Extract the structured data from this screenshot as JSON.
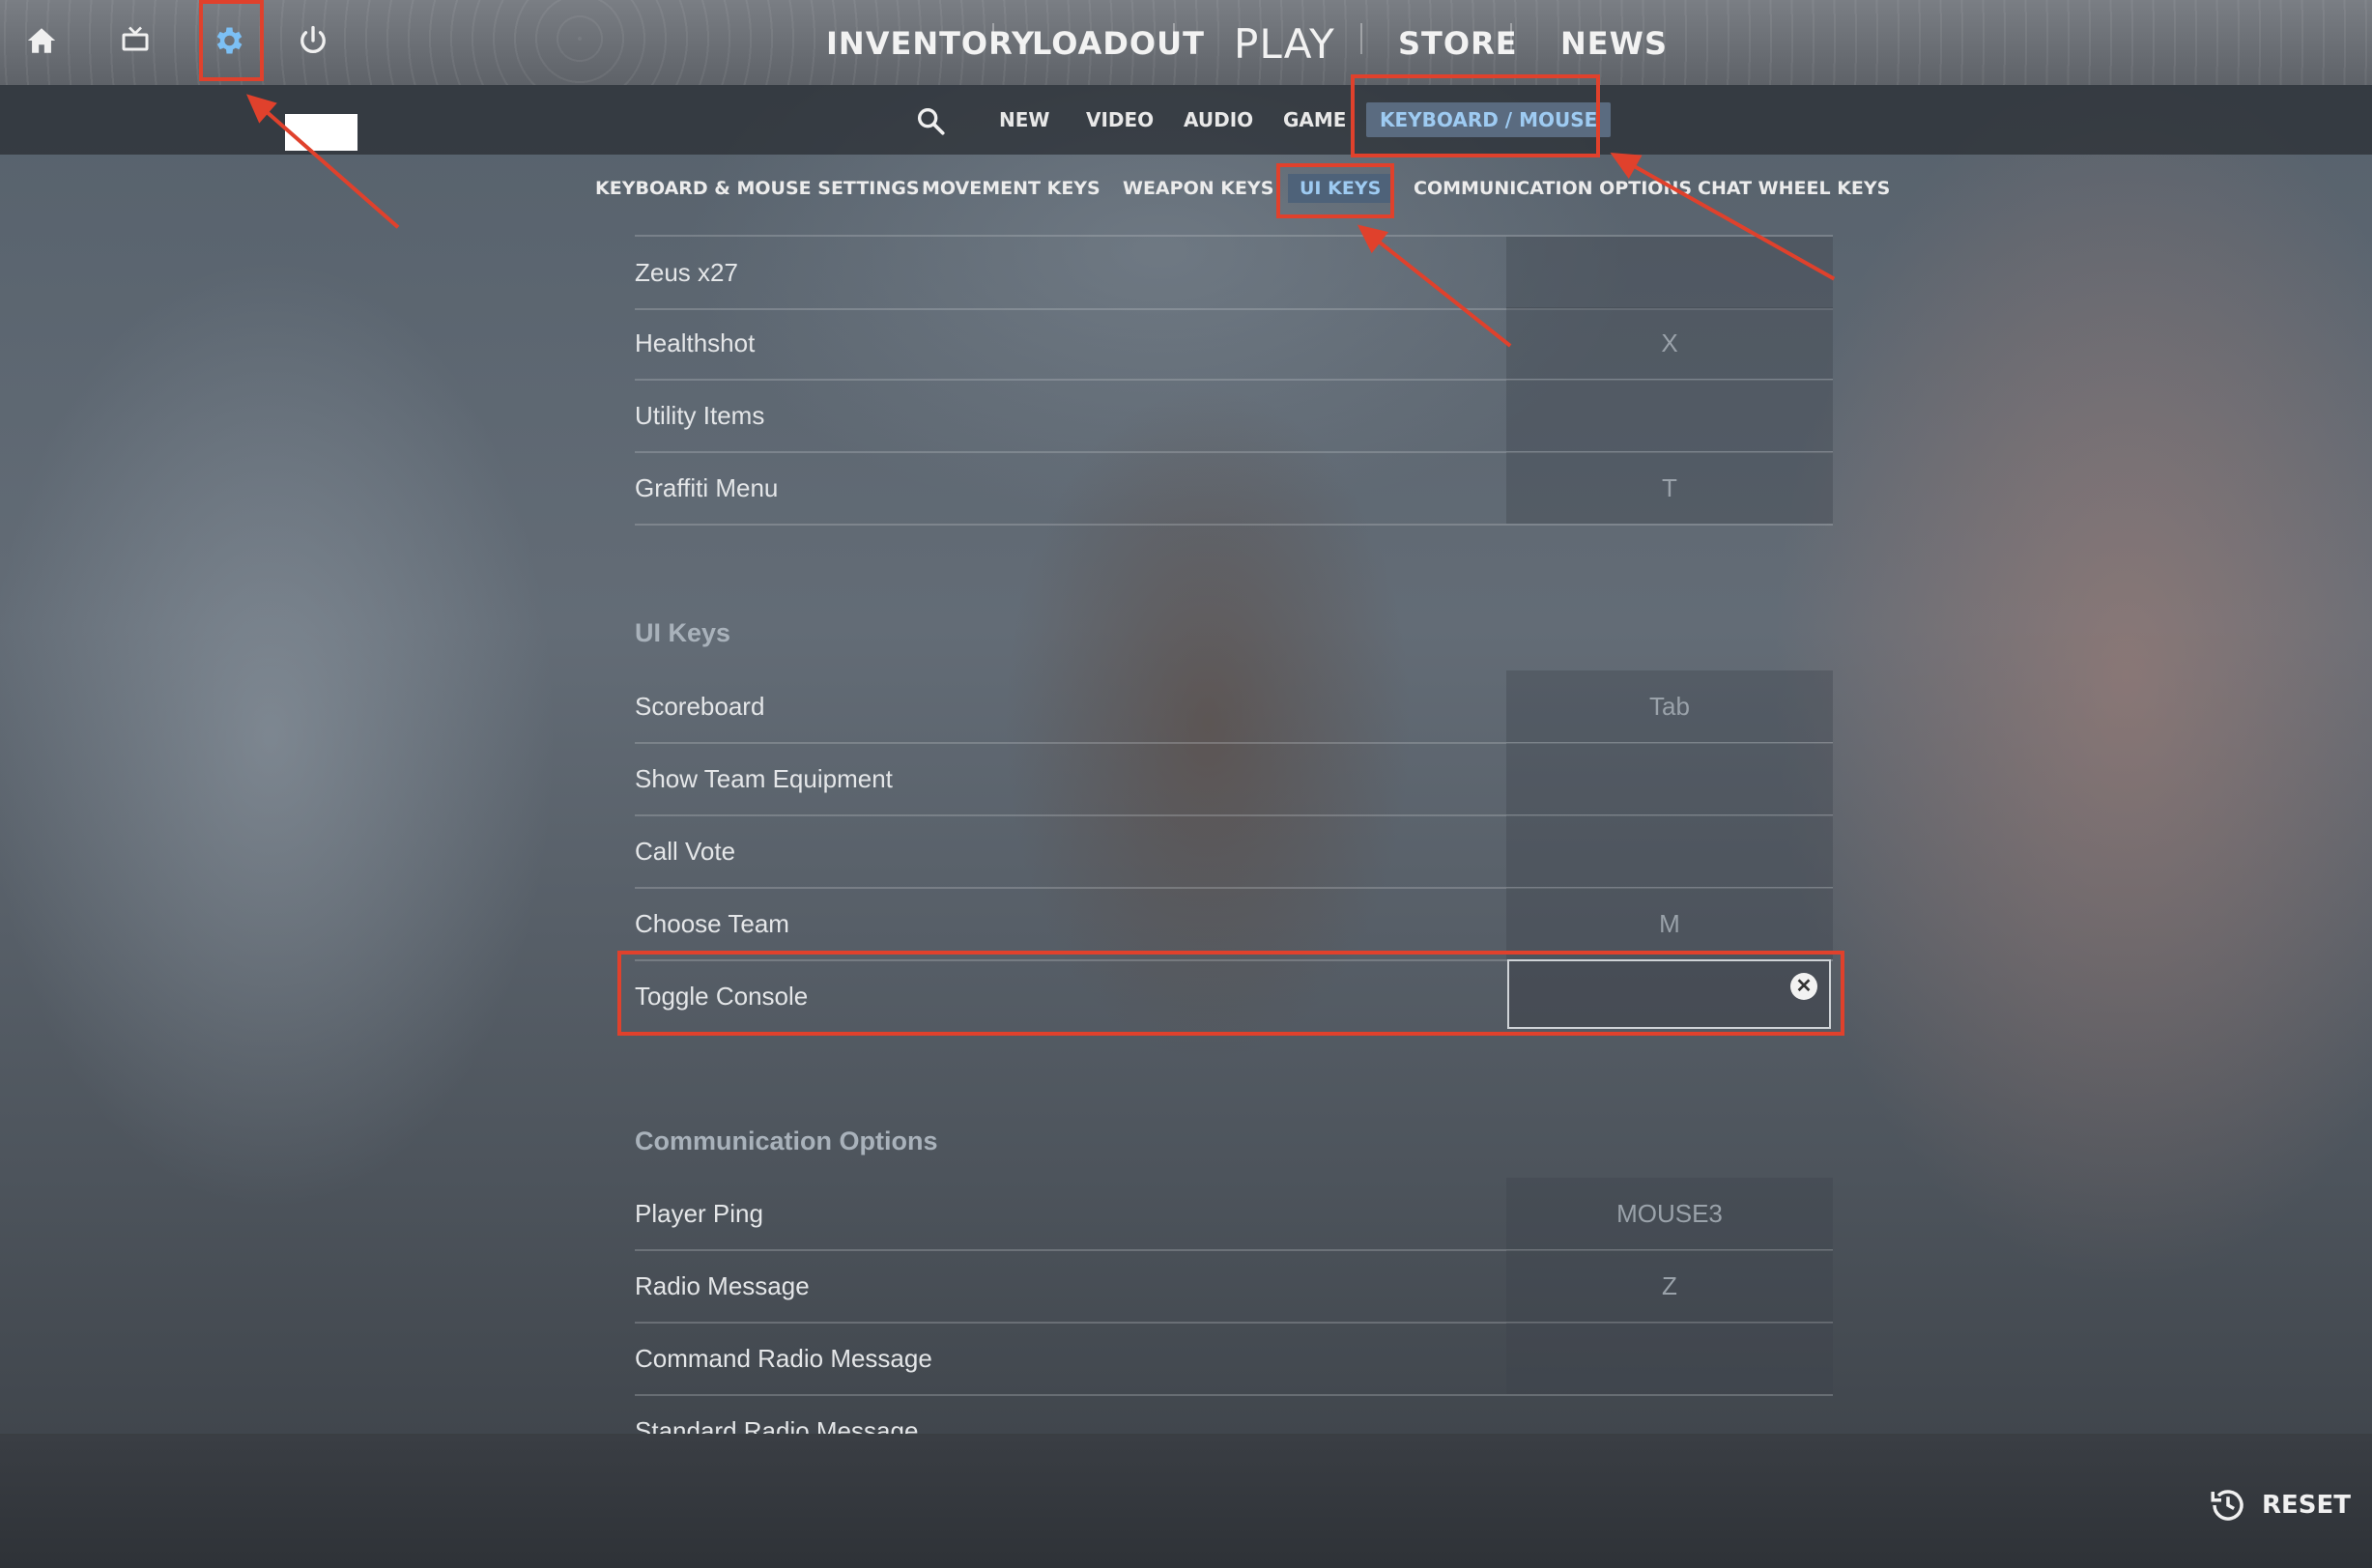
{
  "top_nav": {
    "items": [
      "INVENTORY",
      "LOADOUT",
      "PLAY",
      "STORE",
      "NEWS"
    ]
  },
  "settings_tabs": {
    "items": [
      "NEW",
      "VIDEO",
      "AUDIO",
      "GAME",
      "KEYBOARD / MOUSE"
    ],
    "active": "KEYBOARD / MOUSE"
  },
  "sub_tabs": {
    "items": [
      "KEYBOARD & MOUSE SETTINGS",
      "MOVEMENT KEYS",
      "WEAPON KEYS",
      "UI KEYS",
      "COMMUNICATION OPTIONS",
      "CHAT WHEEL KEYS"
    ],
    "active": "UI KEYS"
  },
  "weapon_rows": [
    {
      "label": "Zeus x27",
      "key": ""
    },
    {
      "label": "Healthshot",
      "key": "X"
    },
    {
      "label": "Utility Items",
      "key": ""
    },
    {
      "label": "Graffiti Menu",
      "key": "T"
    }
  ],
  "ui_keys": {
    "title": "UI Keys",
    "rows": [
      {
        "label": "Scoreboard",
        "key": "Tab"
      },
      {
        "label": "Show Team Equipment",
        "key": ""
      },
      {
        "label": "Call Vote",
        "key": ""
      },
      {
        "label": "Choose Team",
        "key": "M"
      },
      {
        "label": "Toggle Console",
        "key": ""
      }
    ]
  },
  "communication": {
    "title": "Communication Options",
    "rows": [
      {
        "label": "Player Ping",
        "key": "MOUSE3"
      },
      {
        "label": "Radio Message",
        "key": "Z"
      },
      {
        "label": "Command Radio Message",
        "key": ""
      },
      {
        "label": "Standard Radio Message",
        "key": ""
      }
    ]
  },
  "footer": {
    "reset_label": "RESET"
  },
  "colors": {
    "accent_blue": "#9ecbf2",
    "annotation_red": "#e0412c"
  },
  "icons": [
    "home-icon",
    "tv-icon",
    "gear-icon",
    "power-icon",
    "search-icon",
    "clear-icon",
    "history-icon"
  ]
}
